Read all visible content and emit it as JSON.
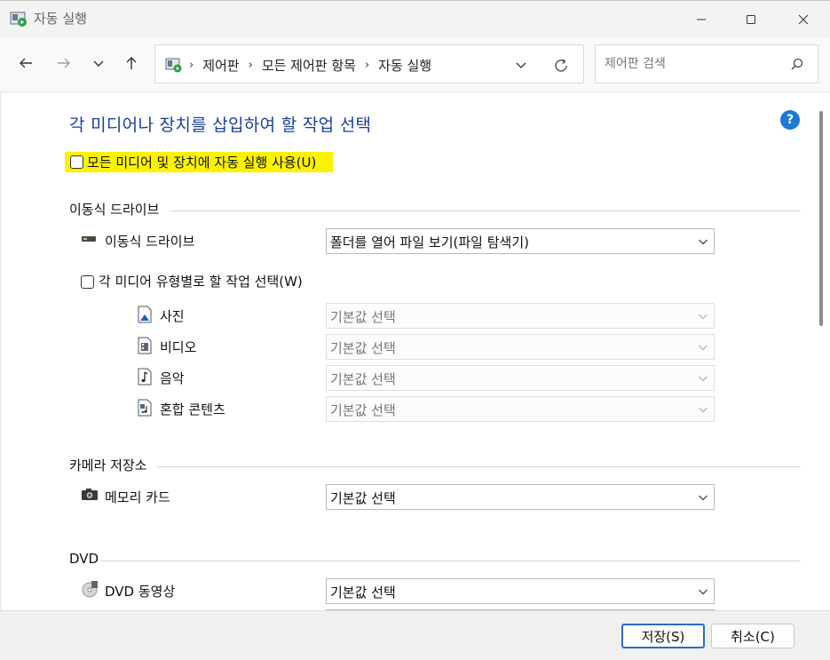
{
  "window": {
    "title": "자동 실행",
    "icon": "autoplay-icon"
  },
  "nav": {
    "breadcrumbs": [
      "제어판",
      "모든 제어판 항목",
      "자동 실행"
    ],
    "search_placeholder": "제어판 검색"
  },
  "main": {
    "heading": "각 미디어나 장치를 삽입하여 할 작업 선택",
    "use_autoplay_label": "모든 미디어 및 장치에 자동 실행 사용(U)",
    "use_autoplay_checked": false,
    "sections": {
      "removable": {
        "title": "이동식 드라이브",
        "drive_label": "이동식 드라이브",
        "drive_value": "폴더를 열어 파일 보기(파일 탐색기)",
        "per_type_label": "각 미디어 유형별로 할 작업 선택(W)",
        "per_type_checked": false,
        "media_types": [
          {
            "label": "사진",
            "value": "기본값 선택",
            "icon": "photo-icon"
          },
          {
            "label": "비디오",
            "value": "기본값 선택",
            "icon": "video-icon"
          },
          {
            "label": "음악",
            "value": "기본값 선택",
            "icon": "music-icon"
          },
          {
            "label": "혼합 콘텐츠",
            "value": "기본값 선택",
            "icon": "mixed-content-icon"
          }
        ]
      },
      "camera": {
        "title": "카메라 저장소",
        "memory_card_label": "메모리 카드",
        "memory_card_value": "기본값 선택"
      },
      "dvd": {
        "title": "DVD",
        "dvd_video_label": "DVD 동영상",
        "dvd_video_value": "기본값 선택"
      }
    }
  },
  "footer": {
    "save_label": "저장(S)",
    "cancel_label": "취소(C)"
  },
  "colors": {
    "heading": "#1c3f9a",
    "highlight": "#fbf200",
    "help": "#1d78d6",
    "primary_border": "#2a6bc9"
  }
}
